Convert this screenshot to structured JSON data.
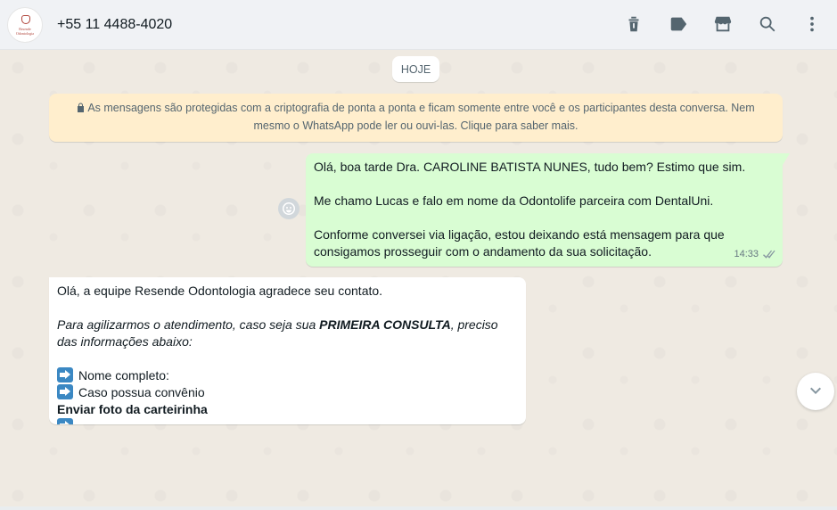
{
  "header": {
    "contact_name": "+55 11 4488-4020",
    "avatar_logo_text": "Resende Odontologia",
    "icons": [
      "delete-icon",
      "label-icon",
      "store-icon",
      "search-icon",
      "menu-icon"
    ]
  },
  "chat": {
    "date_chip": "HOJE",
    "encryption_notice": "As mensagens são protegidas com a criptografia de ponta a ponta e ficam somente entre você e os participantes desta conversa. Nem mesmo o WhatsApp pode ler ou ouvi-las. Clique para saber mais.",
    "outgoing": {
      "line1": "Olá, boa tarde Dra. CAROLINE BATISTA NUNES, tudo bem? Estimo que sim.",
      "line2": "Me chamo Lucas e falo em nome da Odontolife parceira com DentalUni.",
      "line3": "Conforme conversei via ligação, estou deixando está mensagem para que consigamos prosseguir com o andamento da sua solicitação.",
      "time": "14:33",
      "status": "delivered"
    },
    "incoming": {
      "line1": "Olá, a equipe Resende Odontologia agradece seu contato.",
      "line2_pre": "Para agilizarmos o atendimento, caso seja sua ",
      "line2_bold": "PRIMEIRA CONSULTA",
      "line2_post": ", preciso das informações abaixo:",
      "item1": "Nome completo:",
      "item2": "Caso possua convênio",
      "bold_line": "Enviar foto da carteirinha"
    }
  },
  "colors": {
    "outgoing_bg": "#d9fdd3",
    "incoming_bg": "#ffffff",
    "encryption_bg": "#ffeecd",
    "chat_bg": "#efeae2",
    "header_bg": "#f0f2f5"
  }
}
